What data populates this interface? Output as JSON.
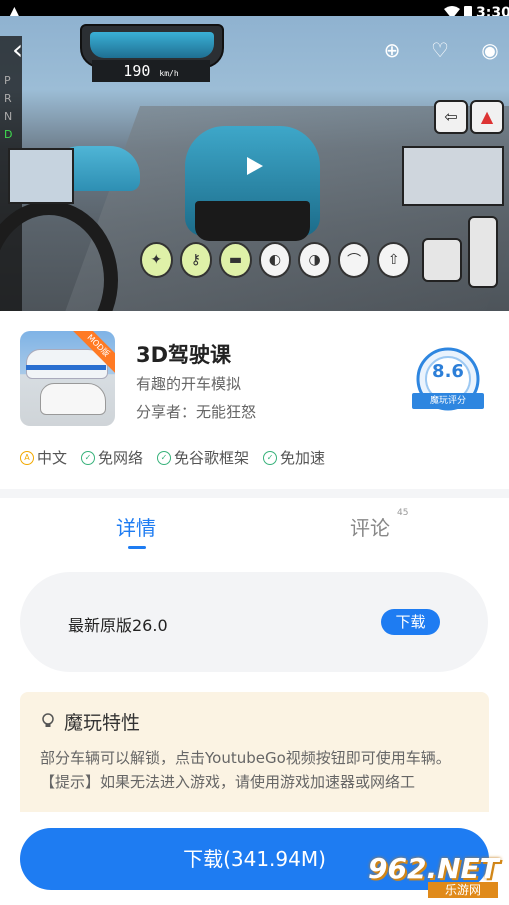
{
  "status_bar": {
    "time": "3:30",
    "warning_icon": "warning-icon"
  },
  "media": {
    "speed_value": "190",
    "speed_unit": "km/h",
    "gears": [
      "P",
      "R",
      "N",
      "D"
    ],
    "controls": [
      "seatbelt-icon",
      "key-icon",
      "handbrake-icon",
      "headlight-icon",
      "highbeam-icon",
      "wiper-icon",
      "arrow-up-icon"
    ]
  },
  "app": {
    "name": "3D驾驶课",
    "subtitle": "有趣的开车模拟",
    "sharer": "分享者：无能狂怒",
    "icon_badge": "MOD版",
    "rating_score": "8.6",
    "rating_label": "魔玩评分"
  },
  "tags": [
    {
      "label": "中文",
      "icon": "a-icon"
    },
    {
      "label": "免网络",
      "icon": "check-icon"
    },
    {
      "label": "免谷歌框架",
      "icon": "check-icon"
    },
    {
      "label": "免加速",
      "icon": "check-icon"
    }
  ],
  "tabs": {
    "details_label": "详情",
    "comments_label": "评论",
    "comments_count": "45"
  },
  "version": {
    "label": "最新原版26.0",
    "button": "下载"
  },
  "features": {
    "title": "魔玩特性",
    "line1": "部分车辆可以解锁，点击YoutubeGo视频按钮即可使用车辆。",
    "line2": "【提示】如果无法进入游戏，请使用游戏加速器或网络工"
  },
  "download": {
    "label": "下载(341.94M)"
  },
  "watermark": {
    "main": "962.NET",
    "sub": "乐游网"
  },
  "colors": {
    "accent": "#1e7cf2",
    "feature_bg": "#fbf3e3"
  }
}
